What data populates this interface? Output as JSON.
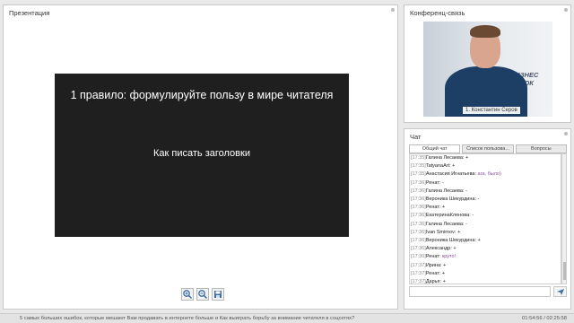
{
  "presentation": {
    "title": "Презентация",
    "slide_title": "1 правило: формулируйте пользу в мире читателя",
    "slide_subtitle": "Как писать заголовки",
    "tools": {
      "zoom_in_icon": "zoom-in-icon",
      "zoom_out_icon": "zoom-out-icon",
      "save_icon": "save-icon"
    }
  },
  "conference": {
    "title": "Конференц-связь",
    "video_caption": "1. Константин Серов",
    "wall_text_line1": "БИЗНЕС",
    "wall_text_line2": "ОСТОК"
  },
  "chat": {
    "title": "Чат",
    "tabs": [
      "Общий чат",
      "Список пользова...",
      "Вопросы"
    ],
    "messages": [
      {
        "time": "[17:35]",
        "name": "Галина Лесаева:",
        "text": " +"
      },
      {
        "time": "[17:35]",
        "name": "TatyanaArt:",
        "text": " +"
      },
      {
        "time": "[17:35]",
        "name": "Анастасия Игнатьева:",
        "text": " ага, было)"
      },
      {
        "time": "[17:36]",
        "name": "Ренат:",
        "text": " -"
      },
      {
        "time": "[17:36]",
        "name": "Галина Лесаева:",
        "text": " -"
      },
      {
        "time": "[17:36]",
        "name": "Вероника Шекурдина:",
        "text": " -"
      },
      {
        "time": "[17:36]",
        "name": "Ренат:",
        "text": " +"
      },
      {
        "time": "[17:36]",
        "name": "ЕкатеринаКленова:",
        "text": " -"
      },
      {
        "time": "[17:36]",
        "name": "Галина Лесаева:",
        "text": " -"
      },
      {
        "time": "[17:36]",
        "name": "Ivan Smirnov:",
        "text": " +"
      },
      {
        "time": "[17:36]",
        "name": "Вероника Шекурдина:",
        "text": " +"
      },
      {
        "time": "[17:36]",
        "name": "Александр:",
        "text": " +"
      },
      {
        "time": "[17:30]",
        "name": "Ренат:",
        "text": " круто!"
      },
      {
        "time": "[17:37]",
        "name": "Ирина:",
        "text": " +"
      },
      {
        "time": "[17:37]",
        "name": "Ренат:",
        "text": " +"
      },
      {
        "time": "[17:37]",
        "name": "Дарья:",
        "text": " +"
      },
      {
        "time": "[17:37]",
        "name": "Марина:",
        "text": " +"
      },
      {
        "time": "[17:37]",
        "name": "Марина:",
        "text": " Очень интересно"
      },
      {
        "time": "[17:37]",
        "name": "Сергей:",
        "text": " +"
      },
      {
        "time": "[17:37]",
        "name": "TatyanaArt:",
        "text": " +"
      }
    ],
    "send_icon": "send-icon"
  },
  "status": {
    "left": "5 самых больших ошибок, которые мешают Вам продавать в интернете больше и Как выиграть борьбу за внимание читателя в соцсетях?",
    "right": "01:54:56 / 02:25:58"
  },
  "colors": {
    "background": "#e9e9e9",
    "slide": "#1f1f1f",
    "accent": "#3b6ea8"
  }
}
